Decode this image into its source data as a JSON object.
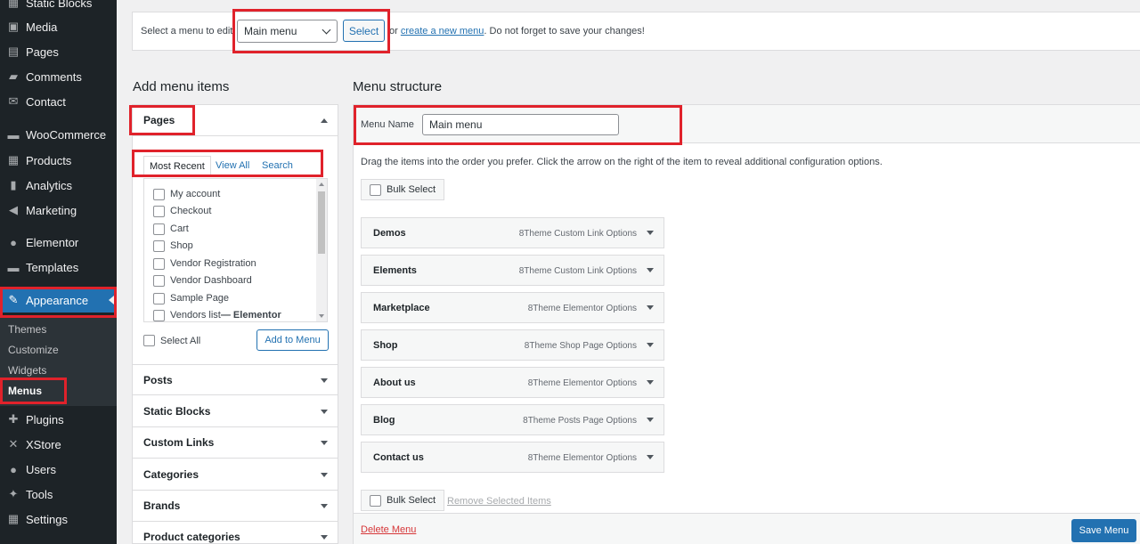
{
  "sidebar": {
    "items": [
      {
        "label": "Static Blocks",
        "icon": "grid-icon",
        "glyph": "▦"
      },
      {
        "label": "Media",
        "icon": "media-icon",
        "glyph": "▣"
      },
      {
        "label": "Pages",
        "icon": "pages-icon",
        "glyph": "▤"
      },
      {
        "label": "Comments",
        "icon": "comments-icon",
        "glyph": "▰"
      },
      {
        "label": "Contact",
        "icon": "mail-icon",
        "glyph": "✉"
      },
      {
        "label": "WooCommerce",
        "icon": "woocommerce-icon",
        "glyph": "▬"
      },
      {
        "label": "Products",
        "icon": "products-icon",
        "glyph": "▦"
      },
      {
        "label": "Analytics",
        "icon": "analytics-icon",
        "glyph": "▮"
      },
      {
        "label": "Marketing",
        "icon": "megaphone-icon",
        "glyph": "◀"
      },
      {
        "label": "Elementor",
        "icon": "elementor-icon",
        "glyph": "●"
      },
      {
        "label": "Templates",
        "icon": "folder-icon",
        "glyph": "▬"
      },
      {
        "label": "Appearance",
        "icon": "brush-icon",
        "glyph": "✎"
      },
      {
        "label": "Plugins",
        "icon": "plugin-icon",
        "glyph": "✚"
      },
      {
        "label": "XStore",
        "icon": "xstore-icon",
        "glyph": "✕"
      },
      {
        "label": "Users",
        "icon": "users-icon",
        "glyph": "●"
      },
      {
        "label": "Tools",
        "icon": "wrench-icon",
        "glyph": "✦"
      },
      {
        "label": "Settings",
        "icon": "settings-icon",
        "glyph": "▦"
      }
    ],
    "submenu": [
      "Themes",
      "Customize",
      "Widgets",
      "Menus"
    ]
  },
  "top_bar": {
    "prompt": "Select a menu to edit:",
    "selected_menu": "Main menu",
    "select_label": "Select",
    "or_text": "or",
    "create_link": "create a new menu",
    "reminder": ". Do not forget to save your changes!"
  },
  "add_items": {
    "heading": "Add menu items",
    "pages_heading": "Pages",
    "tabs": [
      "Most Recent",
      "View All",
      "Search"
    ],
    "pages": [
      "My account",
      "Checkout",
      "Cart",
      "Shop",
      "Vendor Registration",
      "Vendor Dashboard",
      "Sample Page"
    ],
    "partial_page": "Vendors list",
    "partial_page_suffix": " — Elementor",
    "select_all": "Select All",
    "add_to_menu": "Add to Menu",
    "sections": [
      "Posts",
      "Static Blocks",
      "Custom Links",
      "Categories",
      "Brands",
      "Product categories"
    ]
  },
  "structure": {
    "heading": "Menu structure",
    "name_label": "Menu Name",
    "name_value": "Main menu",
    "instructions": "Drag the items into the order you prefer. Click the arrow on the right of the item to reveal additional configuration options.",
    "bulk_select": "Bulk Select",
    "items": [
      {
        "title": "Demos",
        "type": "8Theme Custom Link Options"
      },
      {
        "title": "Elements",
        "type": "8Theme Custom Link Options"
      },
      {
        "title": "Marketplace",
        "type": "8Theme Elementor Options"
      },
      {
        "title": "Shop",
        "type": "8Theme Shop Page Options"
      },
      {
        "title": "About us",
        "type": "8Theme Elementor Options"
      },
      {
        "title": "Blog",
        "type": "8Theme Posts Page Options"
      },
      {
        "title": "Contact us",
        "type": "8Theme Elementor Options"
      }
    ],
    "remove_selected": "Remove Selected Items",
    "delete_menu": "Delete Menu",
    "save_menu": "Save Menu"
  },
  "colors": {
    "accent": "#2271b1",
    "highlight": "#e0222b",
    "sidebar": "#1d2327"
  }
}
